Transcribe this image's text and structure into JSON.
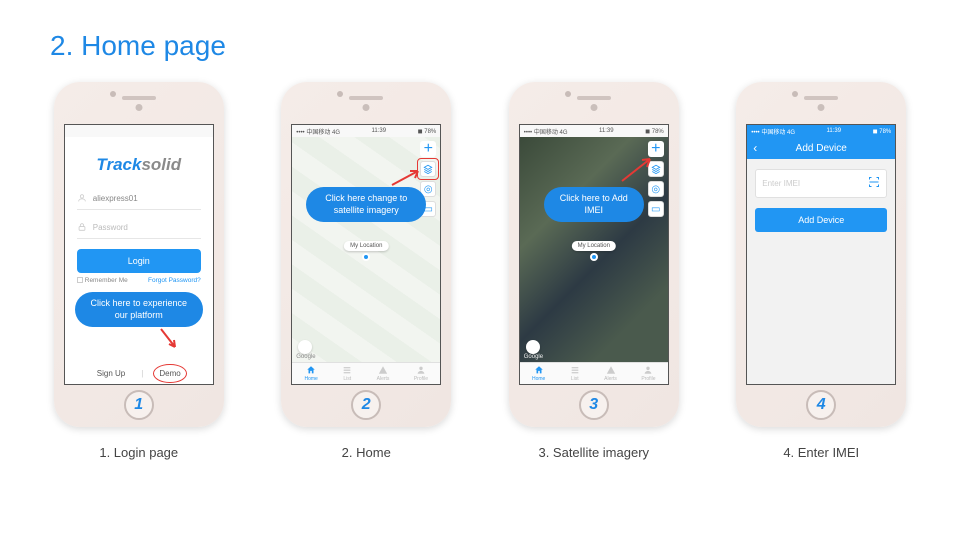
{
  "title": "2. Home page",
  "phones": [
    {
      "num": "1",
      "caption": "1. Login page",
      "statusbar_left": "",
      "statusbar_right": "",
      "logo_part1": "Track",
      "logo_part2": "solid",
      "username": "aliexpress01",
      "password_placeholder": "Password",
      "login_btn": "Login",
      "remember": "Remember Me",
      "forgot": "Forgot Password?",
      "callout": "Click here to experience our platform",
      "signup": "Sign Up",
      "demo": "Demo"
    },
    {
      "num": "2",
      "caption": "2. Home",
      "statusbar_left": "•••• 中国移动 4G",
      "statusbar_time": "11:39",
      "statusbar_right": "◼ 78%",
      "callout": "Click here change to satellite imagery",
      "location_label": "My Location",
      "google": "Google",
      "tabs": [
        "Home",
        "List",
        "Alerts",
        "Profile"
      ]
    },
    {
      "num": "3",
      "caption": "3. Satellite imagery",
      "statusbar_left": "•••• 中国移动 4G",
      "statusbar_time": "11:39",
      "statusbar_right": "◼ 78%",
      "callout": "Click here to Add IMEI",
      "location_label": "My Location",
      "google": "Google",
      "tabs": [
        "Home",
        "List",
        "Alerts",
        "Profile"
      ]
    },
    {
      "num": "4",
      "caption": "4. Enter IMEI",
      "statusbar_left": "•••• 中国移动 4G",
      "statusbar_time": "11:39",
      "statusbar_right": "◼ 78%",
      "nav_title": "Add Device",
      "imei_placeholder": "Enter IMEI",
      "add_btn": "Add Device"
    }
  ]
}
